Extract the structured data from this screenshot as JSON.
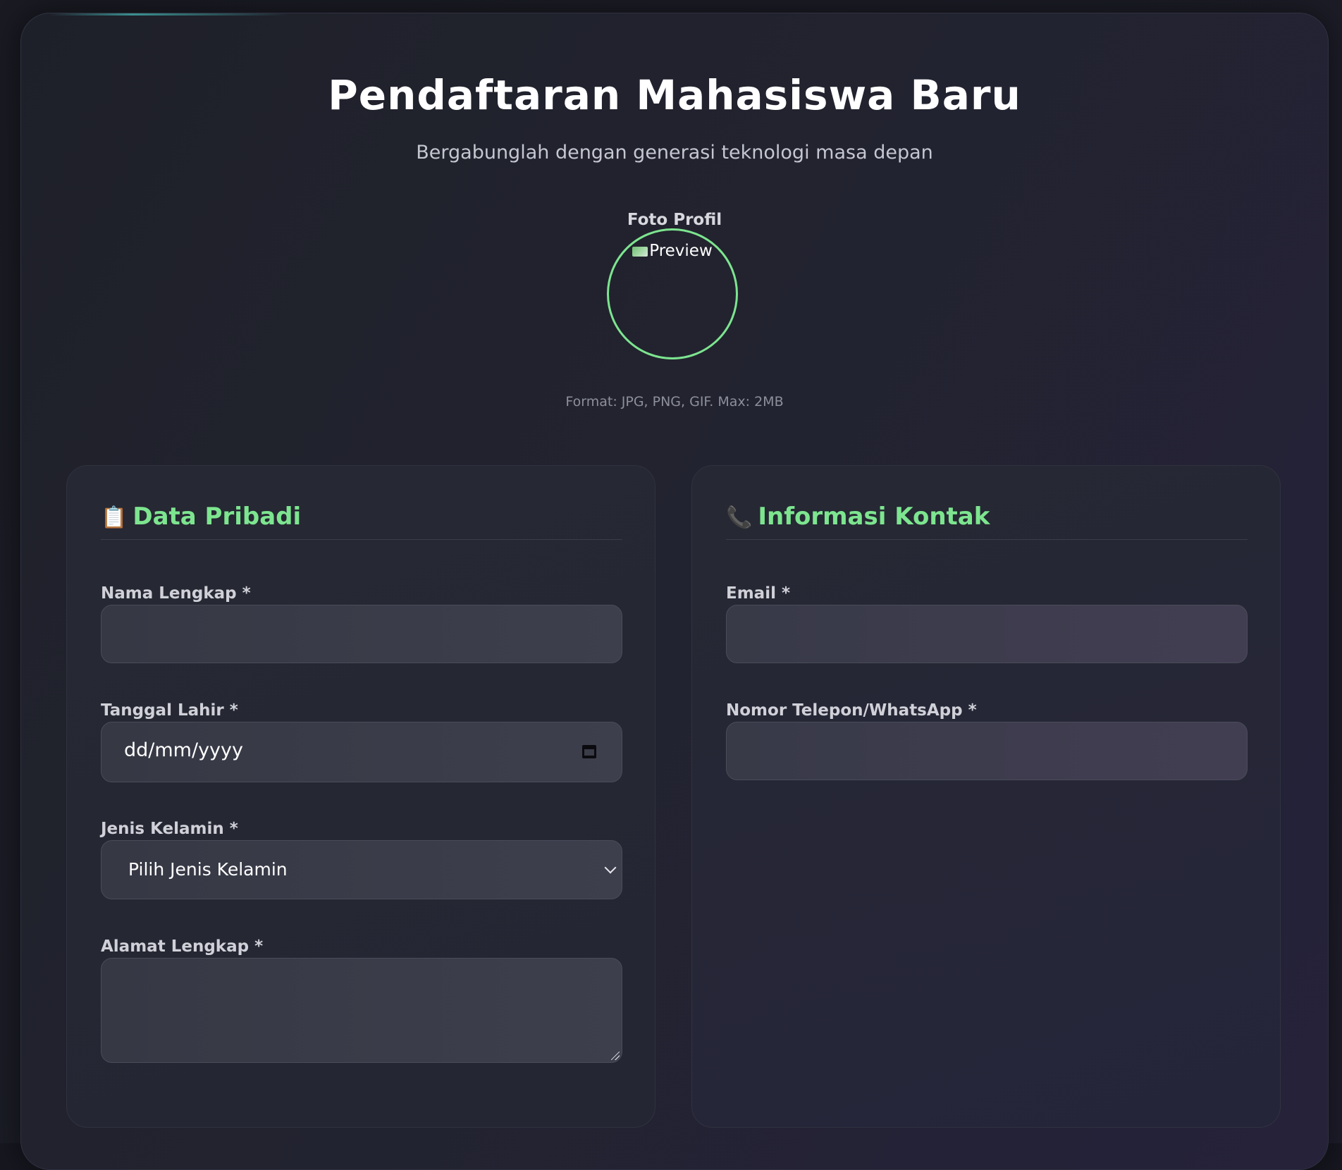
{
  "header": {
    "title": "Pendaftaran Mahasiswa Baru",
    "subtitle": "Bergabunglah dengan generasi teknologi masa depan"
  },
  "photo": {
    "label": "Foto Profil",
    "preview_alt": "Preview",
    "hint": "Format: JPG, PNG, GIF. Max: 2MB",
    "border_color": "#7de58f"
  },
  "sections": {
    "personal": {
      "icon": "clipboard-icon",
      "icon_glyph": "📋",
      "title": "Data Pribadi",
      "fields": {
        "full_name": {
          "label": "Nama Lengkap *",
          "value": ""
        },
        "birth_date": {
          "label": "Tanggal Lahir *",
          "value": "dd/mm/yyyy"
        },
        "gender": {
          "label": "Jenis Kelamin *",
          "value": "Pilih Jenis Kelamin"
        },
        "address": {
          "label": "Alamat Lengkap *",
          "value": ""
        }
      }
    },
    "contact": {
      "icon": "phone-icon",
      "icon_glyph": "📞",
      "title": "Informasi Kontak",
      "fields": {
        "email": {
          "label": "Email *",
          "value": ""
        },
        "phone": {
          "label": "Nomor Telepon/WhatsApp *",
          "value": ""
        }
      }
    }
  },
  "colors": {
    "accent": "#7de58f",
    "background": "#1e2029"
  }
}
